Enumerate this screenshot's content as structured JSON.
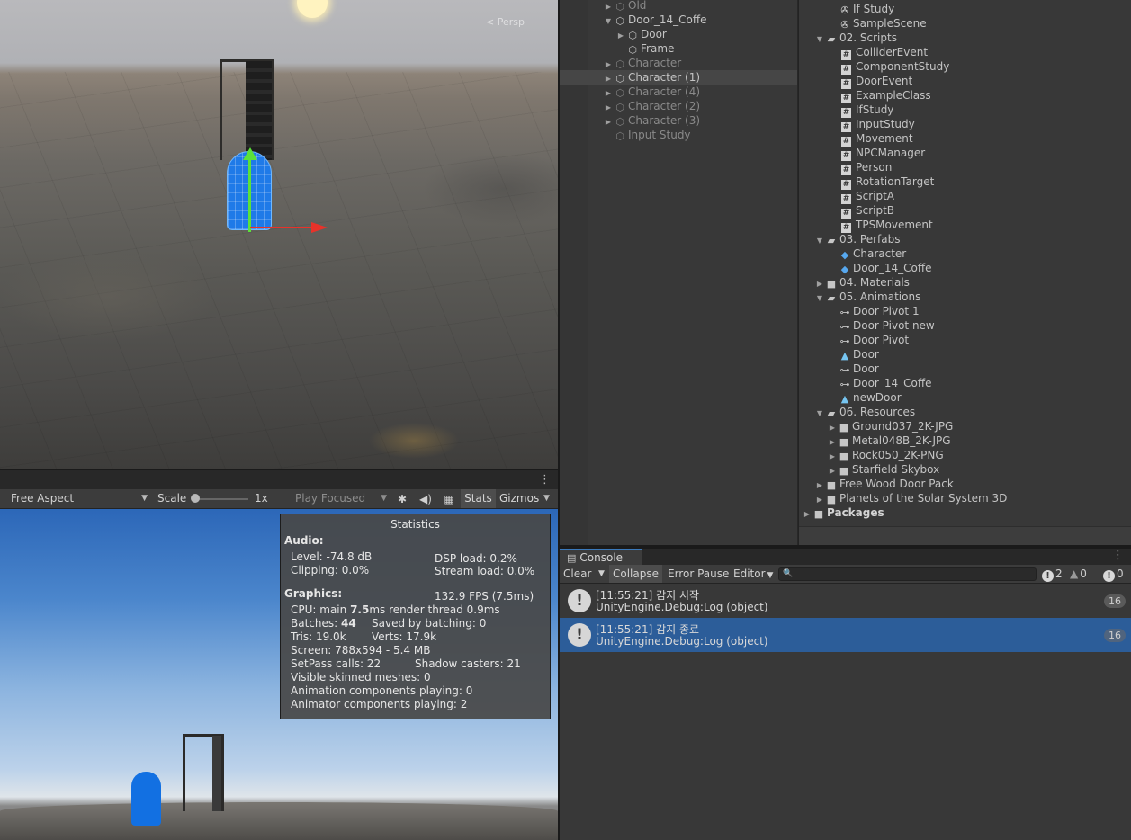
{
  "scene": {
    "view_label": "< Persp"
  },
  "game_toolbar": {
    "aspect": "Free Aspect",
    "scale_label": "Scale",
    "scale_value": "1x",
    "play_mode": "Play Focused",
    "stats_label": "Stats",
    "gizmos_label": "Gizmos"
  },
  "stats": {
    "title": "Statistics",
    "audio_header": "Audio:",
    "level": "Level: -74.8 dB",
    "dsp_load": "DSP load: 0.2%",
    "clipping": "Clipping: 0.0%",
    "stream_load": "Stream load: 0.0%",
    "graphics_header": "Graphics:",
    "fps": "132.9 FPS (7.5ms)",
    "cpu_prefix": "CPU: main ",
    "cpu_main": "7.5",
    "cpu_suffix": "ms  render thread 0.9ms",
    "batches_prefix": "Batches: ",
    "batches": "44",
    "saved_by_batching": "Saved by batching: 0",
    "tris": "Tris: 19.0k",
    "verts": "Verts: 17.9k",
    "screen": "Screen: 788x594 - 5.4 MB",
    "setpass": "SetPass calls: 22",
    "shadow_casters": "Shadow casters: 21",
    "visible_skinned": "Visible skinned meshes: 0",
    "animation_components": "Animation components playing: 0",
    "animator_components": "Animator components playing: 2"
  },
  "hierarchy": {
    "items": [
      {
        "label": "Old"
      },
      {
        "label": "Door_14_Coffe"
      },
      {
        "label": "Door"
      },
      {
        "label": "Frame"
      },
      {
        "label": "Character"
      },
      {
        "label": "Character (1)"
      },
      {
        "label": "Character (4)"
      },
      {
        "label": "Character (2)"
      },
      {
        "label": "Character (3)"
      },
      {
        "label": "Input Study"
      }
    ]
  },
  "project": {
    "items": [
      {
        "label": "If Study"
      },
      {
        "label": "SampleScene"
      },
      {
        "label": "02. Scripts"
      },
      {
        "label": "ColliderEvent"
      },
      {
        "label": "ComponentStudy"
      },
      {
        "label": "DoorEvent"
      },
      {
        "label": "ExampleClass"
      },
      {
        "label": "IfStudy"
      },
      {
        "label": "InputStudy"
      },
      {
        "label": "Movement"
      },
      {
        "label": "NPCManager"
      },
      {
        "label": "Person"
      },
      {
        "label": "RotationTarget"
      },
      {
        "label": "ScriptA"
      },
      {
        "label": "ScriptB"
      },
      {
        "label": "TPSMovement"
      },
      {
        "label": "03. Perfabs"
      },
      {
        "label": "Character"
      },
      {
        "label": "Door_14_Coffe"
      },
      {
        "label": "04. Materials"
      },
      {
        "label": "05. Animations"
      },
      {
        "label": "Door Pivot 1"
      },
      {
        "label": "Door Pivot new"
      },
      {
        "label": "Door Pivot"
      },
      {
        "label": "Door"
      },
      {
        "label": "Door"
      },
      {
        "label": "Door_14_Coffe"
      },
      {
        "label": "newDoor"
      },
      {
        "label": "06. Resources"
      },
      {
        "label": "Ground037_2K-JPG"
      },
      {
        "label": "Metal048B_2K-JPG"
      },
      {
        "label": "Rock050_2K-PNG"
      },
      {
        "label": "Starfield Skybox"
      },
      {
        "label": "Free Wood Door Pack"
      },
      {
        "label": "Planets of the Solar System 3D"
      },
      {
        "label": "Packages"
      }
    ]
  },
  "console": {
    "tab": "Console",
    "clear": "Clear",
    "collapse": "Collapse",
    "error_pause": "Error Pause",
    "editor": "Editor",
    "info_count": "2",
    "warn_count": "0",
    "error_count": "0",
    "logs": [
      {
        "line1": "[11:55:21] 감지 시작",
        "line2": "UnityEngine.Debug:Log (object)",
        "count": "16"
      },
      {
        "line1": "[11:55:21] 감지 종료",
        "line2": "UnityEngine.Debug:Log (object)",
        "count": "16"
      }
    ]
  },
  "colors": {
    "selection": "#2c5d99",
    "panel": "#383838",
    "accent_tab": "#3a79bb"
  }
}
